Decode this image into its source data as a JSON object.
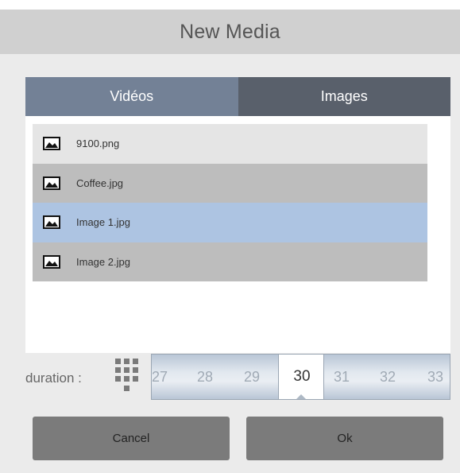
{
  "dialog": {
    "title": "New Media"
  },
  "tabs": [
    {
      "label": "Vidéos"
    },
    {
      "label": "Images"
    }
  ],
  "files": [
    {
      "name": "9100.png",
      "icon": "image-icon"
    },
    {
      "name": "Coffee.jpg",
      "icon": "image-icon"
    },
    {
      "name": "Image 1.jpg",
      "icon": "image-icon",
      "selected": true
    },
    {
      "name": "Image 2.jpg",
      "icon": "image-icon"
    }
  ],
  "duration": {
    "label": "duration :",
    "values": [
      "27",
      "28",
      "29",
      "30",
      "31",
      "32",
      "33"
    ],
    "selected": "30",
    "keypad_icon": "keypad-icon"
  },
  "buttons": {
    "cancel": "Cancel",
    "ok": "Ok"
  },
  "colors": {
    "header_bg": "#d0d0d0",
    "tab_videos": "#738196",
    "tab_images": "#59606b",
    "row_selected": "#adc4e2",
    "row_alt": "#bdbdbd",
    "row_light": "#e5e5e5",
    "button_bg": "#7b7b7b"
  }
}
